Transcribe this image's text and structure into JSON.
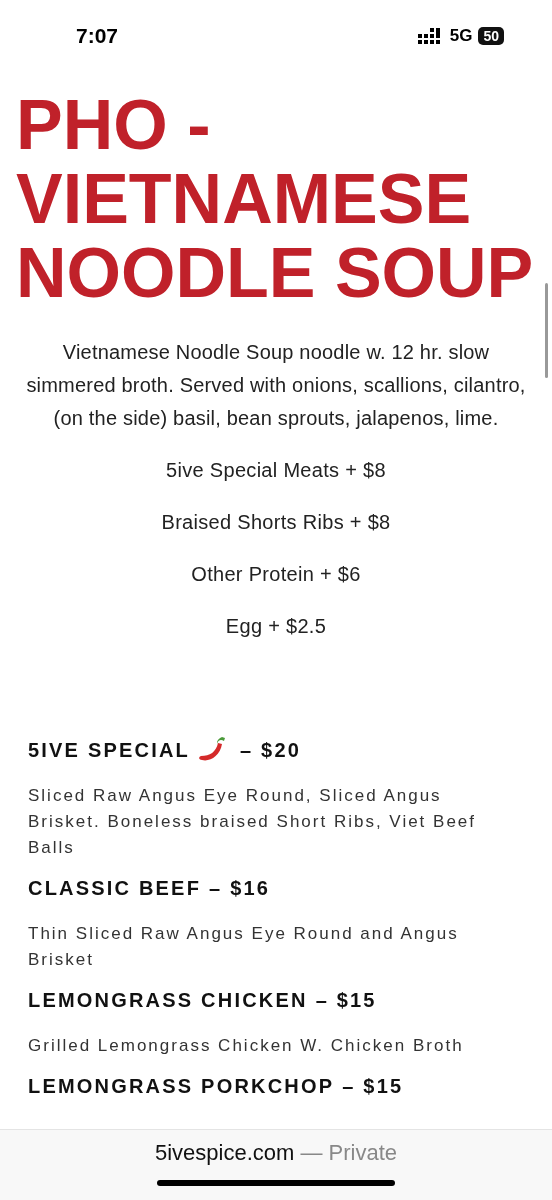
{
  "status_bar": {
    "time": "7:07",
    "network": "5G",
    "battery": "50"
  },
  "title": "PHO - VIETNAMESE NOODLE SOUP",
  "description": "Vietnamese Noodle Soup noodle w. 12 hr. slow simmered broth. Served with onions, scallions, cilantro, (on the side) basil, bean sprouts, jalapenos, lime.",
  "add_ons": [
    "5ive Special Meats + $8",
    "Braised Shorts Ribs + $8",
    "Other Protein + $6",
    "Egg + $2.5"
  ],
  "menu_items": [
    {
      "name": "5IVE SPECIAL",
      "spicy": true,
      "price": "– $20",
      "description": "Sliced Raw Angus Eye Round, Sliced Angus Brisket. Boneless braised Short Ribs, Viet Beef Balls"
    },
    {
      "name": "CLASSIC BEEF",
      "spicy": false,
      "price": "– $16",
      "description": "Thin Sliced Raw Angus Eye Round and Angus Brisket"
    },
    {
      "name": "LEMONGRASS CHICKEN",
      "spicy": false,
      "price": "– $15",
      "description": "Grilled Lemongrass Chicken W. Chicken Broth"
    },
    {
      "name": "LEMONGRASS PORKCHOP",
      "spicy": false,
      "price": "– $15"
    }
  ],
  "browser_bar": {
    "domain": "5ivespice.com",
    "mode": "— Private"
  }
}
